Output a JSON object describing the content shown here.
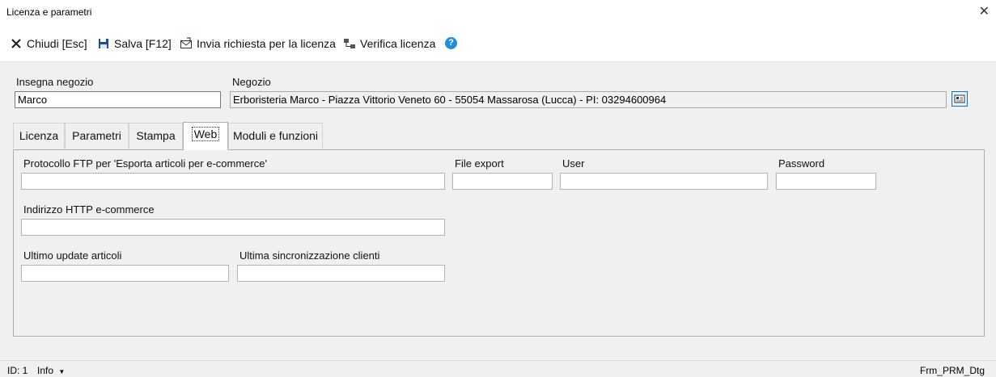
{
  "window": {
    "title": "Licenza e parametri"
  },
  "toolbar": {
    "close_label": "Chiudi [Esc]",
    "save_label": "Salva [F12]",
    "send_label": "Invia richiesta per la licenza",
    "verify_label": "Verifica licenza",
    "help_glyph": "?"
  },
  "header": {
    "insegna_label": "Insegna negozio",
    "insegna_value": "Marco",
    "negozio_label": "Negozio",
    "negozio_value": "Erboristeria Marco - Piazza Vittorio Veneto 60 - 55054 Massarosa (Lucca) - PI: 03294600964"
  },
  "tabs": [
    "Licenza",
    "Parametri",
    "Stampa",
    "Web",
    "Moduli e funzioni"
  ],
  "active_tab": "Web",
  "web": {
    "ftp_label": "Protocollo FTP per 'Esporta articoli per e-commerce'",
    "ftp_value": "",
    "file_export_label": "File export",
    "file_export_value": "",
    "user_label": "User",
    "user_value": "",
    "password_label": "Password",
    "password_value": "",
    "http_label": "Indirizzo HTTP e-commerce",
    "http_value": "",
    "update_label": "Ultimo update articoli",
    "update_value": "",
    "sync_label": "Ultima sincronizzazione clienti",
    "sync_value": ""
  },
  "status": {
    "id": "ID: 1",
    "info": "Info",
    "form_name": "Frm_PRM_Dtg"
  },
  "colors": {
    "help_icon": "#1e90d8",
    "save_icon": "#1f4e8c",
    "accent_border": "#1a6fb0"
  }
}
